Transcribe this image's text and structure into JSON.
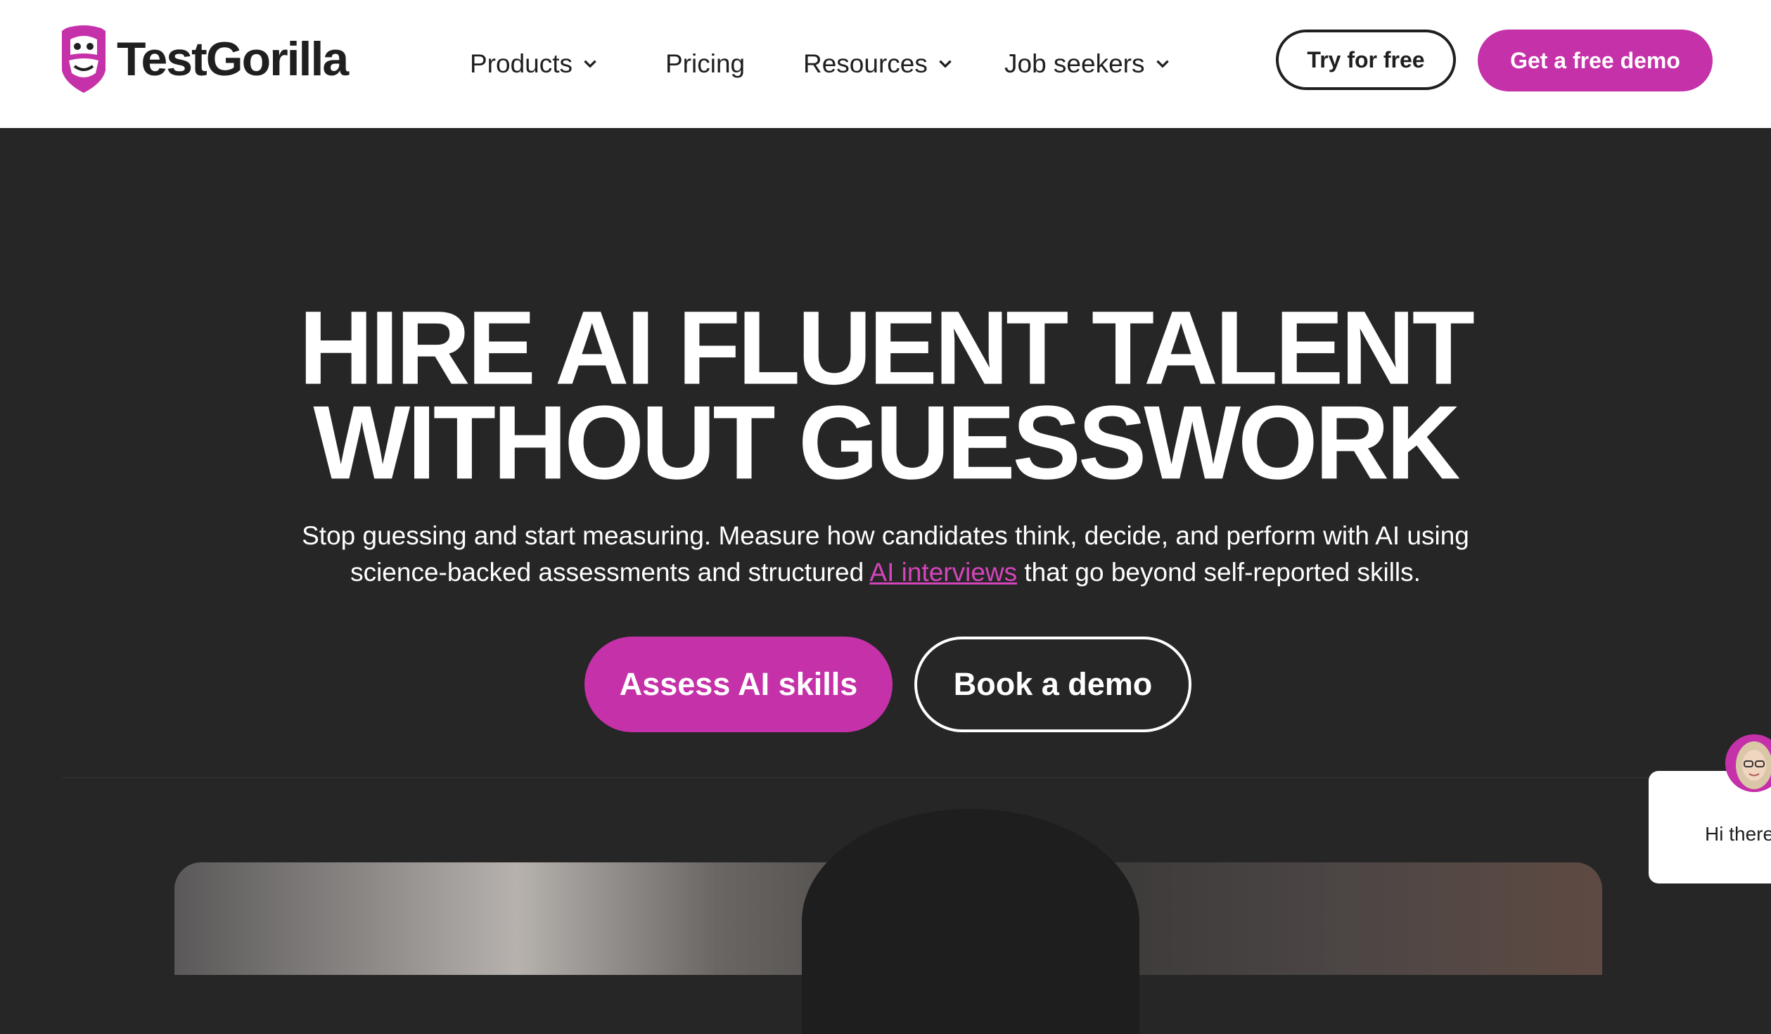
{
  "brand": {
    "name": "TestGorilla",
    "accent_color": "#c531a8",
    "logo_icon": "gorilla-icon"
  },
  "nav": {
    "items": [
      {
        "label": "Products",
        "has_dropdown": true
      },
      {
        "label": "Pricing",
        "has_dropdown": false
      },
      {
        "label": "Resources",
        "has_dropdown": true
      },
      {
        "label": "Job seekers",
        "has_dropdown": true
      }
    ],
    "try_free_label": "Try for free",
    "demo_label": "Get a free demo"
  },
  "hero": {
    "title_line1": "HIRE AI FLUENT TALENT",
    "title_line2": "WITHOUT GUESSWORK",
    "subtitle_line1": "Stop guessing and start measuring. Measure how candidates think, decide, and perform with AI using",
    "subtitle_line2_before": "science-backed assessments and structured ",
    "subtitle_link": "AI interviews",
    "subtitle_line2_after": " that go beyond self-reported skills.",
    "primary_cta": "Assess AI skills",
    "secondary_cta": "Book a demo"
  },
  "chat": {
    "greeting": "Hi there"
  },
  "colors": {
    "hero_background": "#262626",
    "header_background": "#ffffff"
  }
}
